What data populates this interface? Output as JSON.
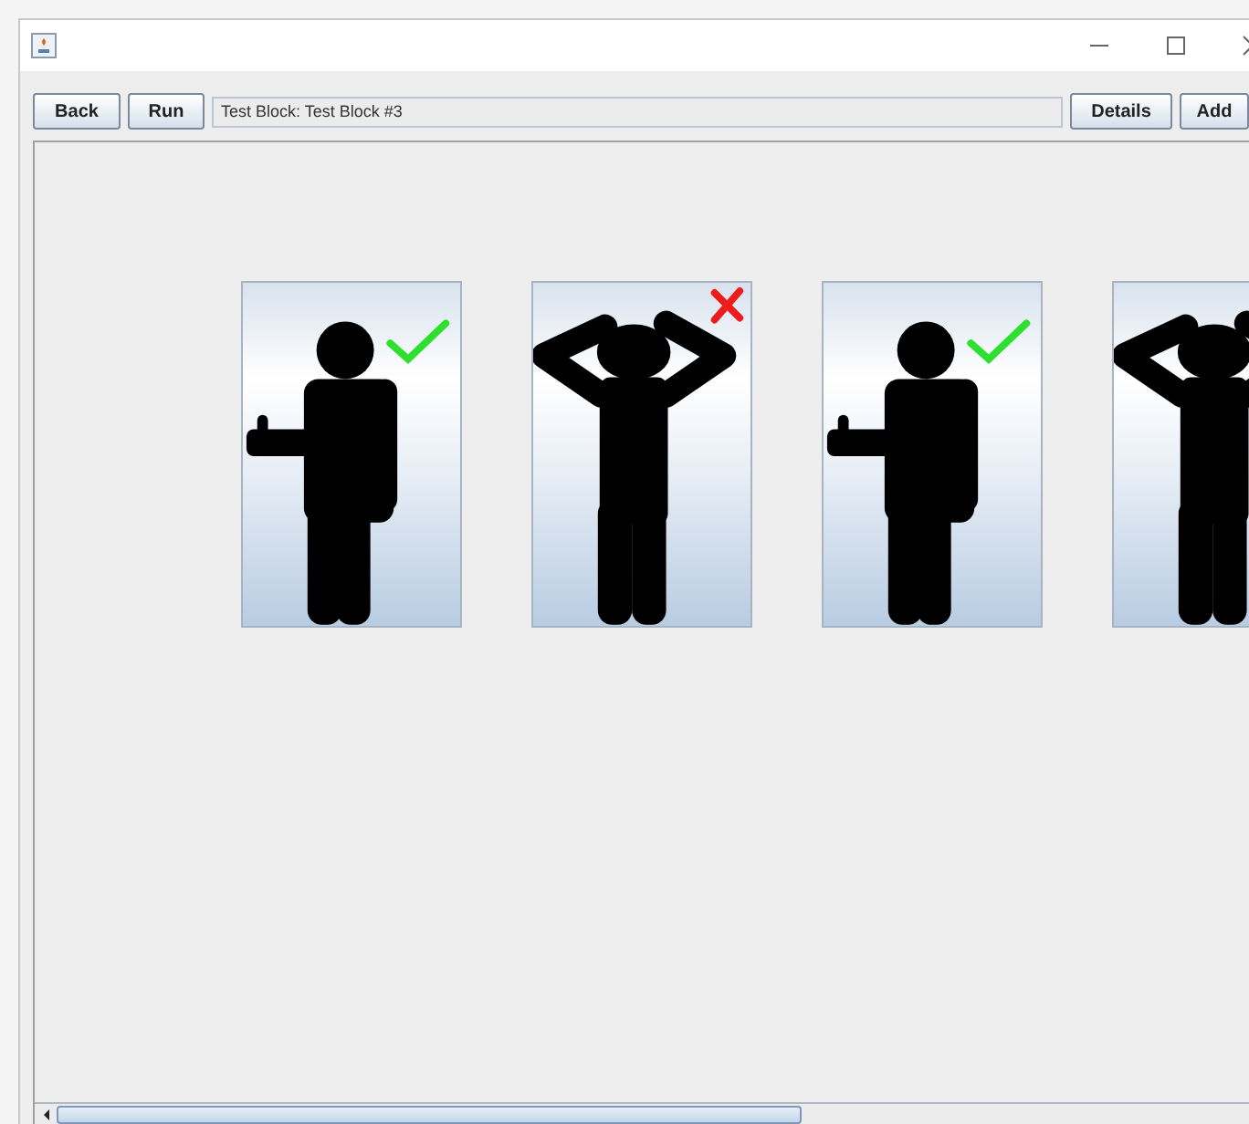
{
  "toolbar": {
    "buttons_left": [
      "Back",
      "Run"
    ],
    "path_field": {
      "value": "Test Block: Test Block #3"
    },
    "buttons_right": [
      "Details",
      "Add"
    ]
  },
  "cards": [
    {
      "kind": "pass",
      "marks": [
        {
          "kind": "check"
        }
      ]
    },
    {
      "kind": "fail",
      "marks": [
        {
          "kind": "cross"
        }
      ]
    },
    {
      "kind": "pass",
      "marks": [
        {
          "kind": "check"
        }
      ]
    },
    {
      "kind": "fail"
    }
  ]
}
